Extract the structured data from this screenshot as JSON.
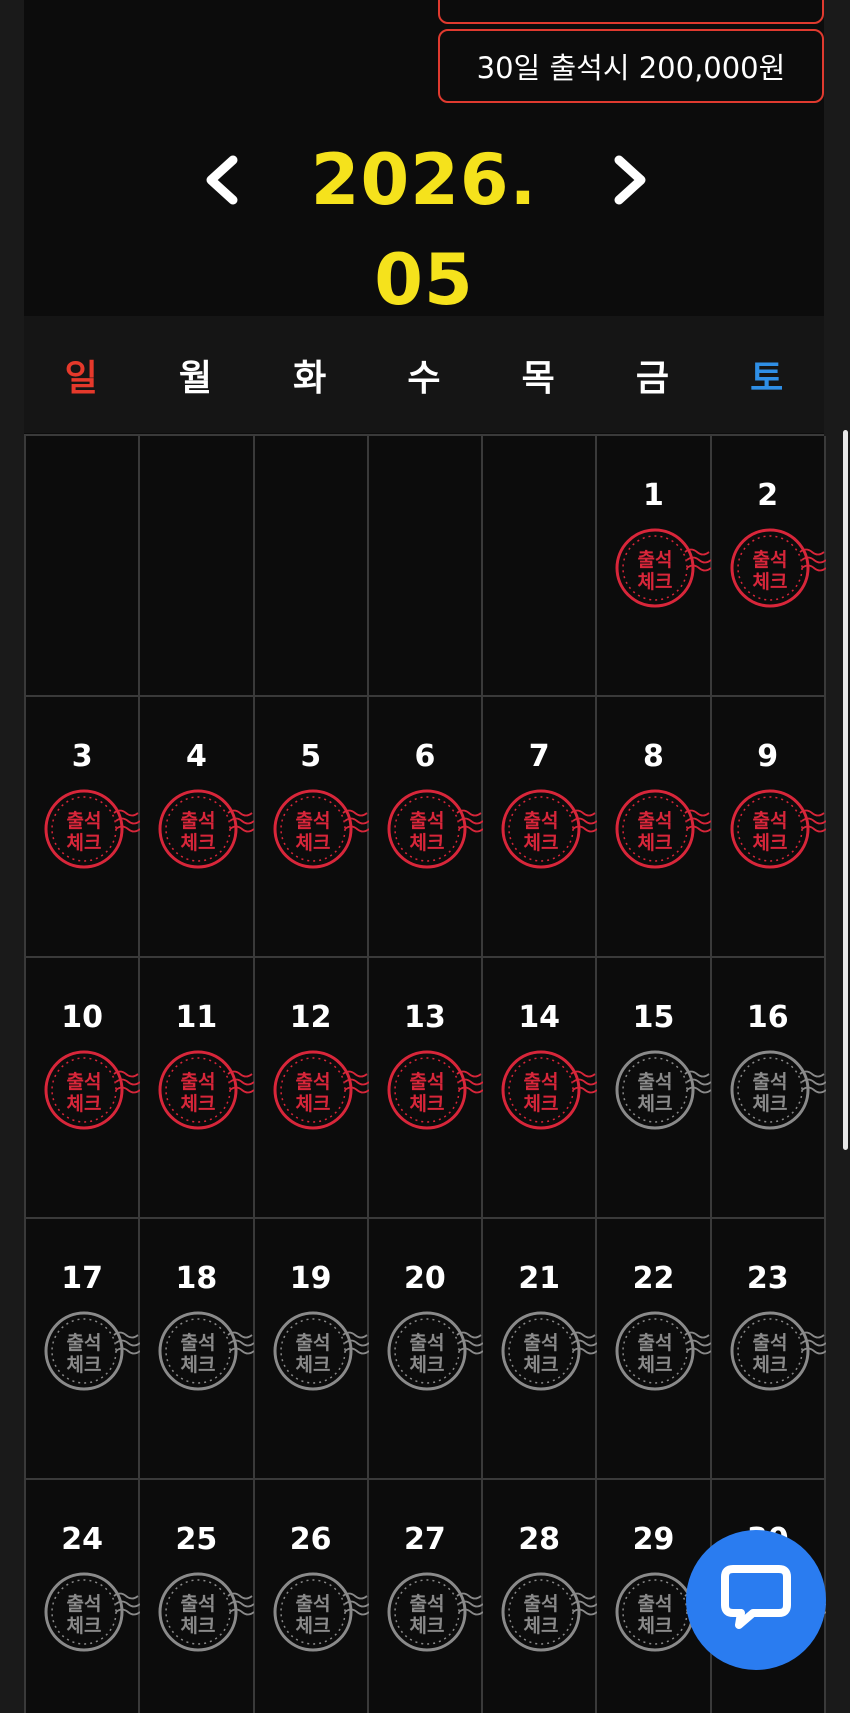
{
  "rewards": [
    {
      "label": ""
    },
    {
      "label": "30일 출석시 200,000원"
    }
  ],
  "calendar": {
    "month_title": "2026. 05",
    "prev_icon": "chevron-left-icon",
    "next_icon": "chevron-right-icon",
    "weekdays": [
      "일",
      "월",
      "화",
      "수",
      "목",
      "금",
      "토"
    ],
    "stamp_text_line1": "출석",
    "stamp_text_line2": "체크",
    "checked_color": "#d8263a",
    "unchecked_color": "#8a8a8a",
    "days": [
      {
        "day": "",
        "stamp": "none"
      },
      {
        "day": "",
        "stamp": "none"
      },
      {
        "day": "",
        "stamp": "none"
      },
      {
        "day": "",
        "stamp": "none"
      },
      {
        "day": "",
        "stamp": "none"
      },
      {
        "day": "1",
        "stamp": "checked"
      },
      {
        "day": "2",
        "stamp": "checked"
      },
      {
        "day": "3",
        "stamp": "checked"
      },
      {
        "day": "4",
        "stamp": "checked"
      },
      {
        "day": "5",
        "stamp": "checked"
      },
      {
        "day": "6",
        "stamp": "checked"
      },
      {
        "day": "7",
        "stamp": "checked"
      },
      {
        "day": "8",
        "stamp": "checked"
      },
      {
        "day": "9",
        "stamp": "checked"
      },
      {
        "day": "10",
        "stamp": "checked"
      },
      {
        "day": "11",
        "stamp": "checked"
      },
      {
        "day": "12",
        "stamp": "checked"
      },
      {
        "day": "13",
        "stamp": "checked"
      },
      {
        "day": "14",
        "stamp": "checked"
      },
      {
        "day": "15",
        "stamp": "unchecked"
      },
      {
        "day": "16",
        "stamp": "unchecked"
      },
      {
        "day": "17",
        "stamp": "unchecked"
      },
      {
        "day": "18",
        "stamp": "unchecked"
      },
      {
        "day": "19",
        "stamp": "unchecked"
      },
      {
        "day": "20",
        "stamp": "unchecked"
      },
      {
        "day": "21",
        "stamp": "unchecked"
      },
      {
        "day": "22",
        "stamp": "unchecked"
      },
      {
        "day": "23",
        "stamp": "unchecked"
      },
      {
        "day": "24",
        "stamp": "unchecked"
      },
      {
        "day": "25",
        "stamp": "unchecked"
      },
      {
        "day": "26",
        "stamp": "unchecked"
      },
      {
        "day": "27",
        "stamp": "unchecked"
      },
      {
        "day": "28",
        "stamp": "unchecked"
      },
      {
        "day": "29",
        "stamp": "unchecked"
      },
      {
        "day": "30",
        "stamp": "unchecked"
      }
    ]
  },
  "chat": {
    "icon": "chat-bubble-icon"
  }
}
